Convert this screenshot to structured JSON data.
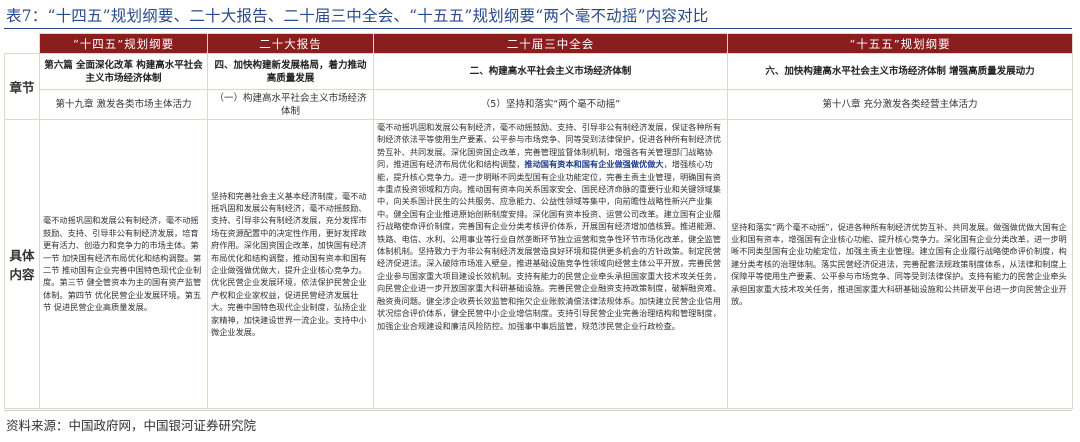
{
  "title": "表7：“十四五”规划纲要、二十大报告、二十届三中全会、“十五五”规划纲要“两个毫不动摇”内容对比",
  "headers": [
    "",
    "“十四五”规划纲要",
    "二十大报告",
    "二十届三中全会",
    "“十五五”规划纲要"
  ],
  "rows": {
    "chapter_label": "章节",
    "content_label": "具体内容"
  },
  "chapters": [
    "第六篇 全面深化改革 构建高水平社会主义市场经济体制",
    "四、加快构建新发展格局，着力推动高质量发展",
    "二、构建高水平社会主义市场经济体制",
    "六、加快构建高水平社会主义市场经济体制 增强高质量发展动力"
  ],
  "sections": [
    "第十九章 激发各类市场主体活力",
    "（一）构建高水平社会主义市场经济体制",
    "（5）坚持和落实“两个毫不动摇”",
    "第十八章 充分激发各类经营主体活力"
  ],
  "content": {
    "c1": "毫不动摇巩固和发展公有制经济，毫不动摇鼓励、支持、引导非公有制经济发展，培育更有活力、创造力和竞争力的市场主体。第一节 加快国有经济布局优化和结构调整。第二节 推动国有企业完善中国特色现代企业制度。第三节 健全管资本为主的国有资产监管体制。第四节 优化民营企业发展环境。第五节 促进民营企业高质量发展。",
    "c2": "坚持和完善社会主义基本经济制度，毫不动摇巩固和发展公有制经济，毫不动摇鼓励、支持、引导非公有制经济发展，充分发挥市场在资源配置中的决定性作用，更好发挥政府作用。深化国资国企改革，加快国有经济布局优化和结构调整，推动国有资本和国有企业做强做优做大，提升企业核心竞争力。优化民营企业发展环境，依法保护民营企业产权和企业家权益，促进民营经济发展壮大。完善中国特色现代企业制度，弘扬企业家精神，加快建设世界一流企业。支持中小微企业发展。",
    "c3_pre": "毫不动摇巩固和发展公有制经济，毫不动摇鼓励、支持、引导非公有制经济发展，保证各种所有制经济依法平等使用生产要素、公平参与市场竞争、同等受到法律保护，促进各种所有制经济优势互补、共同发展。深化国资国企改革，完善管理监督体制机制，增强各有关管理部门战略协同，推进国有经济布局优化和结构调整，",
    "c3_hl": "推动国有资本和国有企业做强做优做大",
    "c3_post": "，增强核心功能，提升核心竞争力。进一步明晰不同类型国有企业功能定位，完善主责主业管理，明确国有资本重点投资领域和方向。推动国有资本向关系国家安全、国民经济命脉的重要行业和关键领域集中，向关系国计民生的公共服务、应急能力、公益性领域等集中，向前瞻性战略性新兴产业集中。健全国有企业推进原始创新制度安排。深化国有资本投资、运营公司改革。建立国有企业履行战略使命评价制度，完善国有企业分类考核评价体系，开展国有经济增加值核算。推进能源、铁路、电信、水利、公用事业等行业自然垄断环节独立运营和竞争性环节市场化改革，健全监管体制机制。坚持致力于为非公有制经济发展营造良好环境和提供更多机会的方针政策。制定民营经济促进法。深入破除市场准入壁垒，推进基础设施竞争性领域向经营主体公平开放，完善民营企业参与国家重大项目建设长效机制。支持有能力的民营企业牵头承担国家重大技术攻关任务，向民营企业进一步开放国家重大科研基础设施。完善民营企业融资支持政策制度，破解融资难、融资贵问题。健全涉企收费长效监管和拖欠企业账款清偿法律法规体系。加快建立民营企业信用状况综合评价体系，健全民营中小企业增信制度。支持引导民营企业完善治理结构和管理制度，加强企业合规建设和廉洁风险防控。加强事中事后监管，规范涉民营企业行政检查。",
    "c4": "坚持和落实“两个毫不动摇”，促进各种所有制经济优势互补、共同发展。做强做优做大国有企业和国有资本，增强国有企业核心功能、提升核心竞争力。深化国有企业分类改革，进一步明晰不同类型国有企业功能定位，加强主责主业管理。建立国有企业履行战略使命评价制度，构建分类考核的治理体制。落实民营经济促进法，完善配套法规政策制度体系，从法律和制度上保障平等使用生产要素、公平参与市场竞争、同等受到法律保护。支持有能力的民营企业牵头承担国家重大技术攻关任务，推进国家重大科研基础设施和公共研发平台进一步向民营企业开放。"
  },
  "source": "资料来源：中国政府网，中国银河证券研究院",
  "colors": {
    "header_bg": "#8a1e1e",
    "title": "#2b4a8b",
    "highlight": "#1f3d8a",
    "border": "#e0d6c6"
  }
}
